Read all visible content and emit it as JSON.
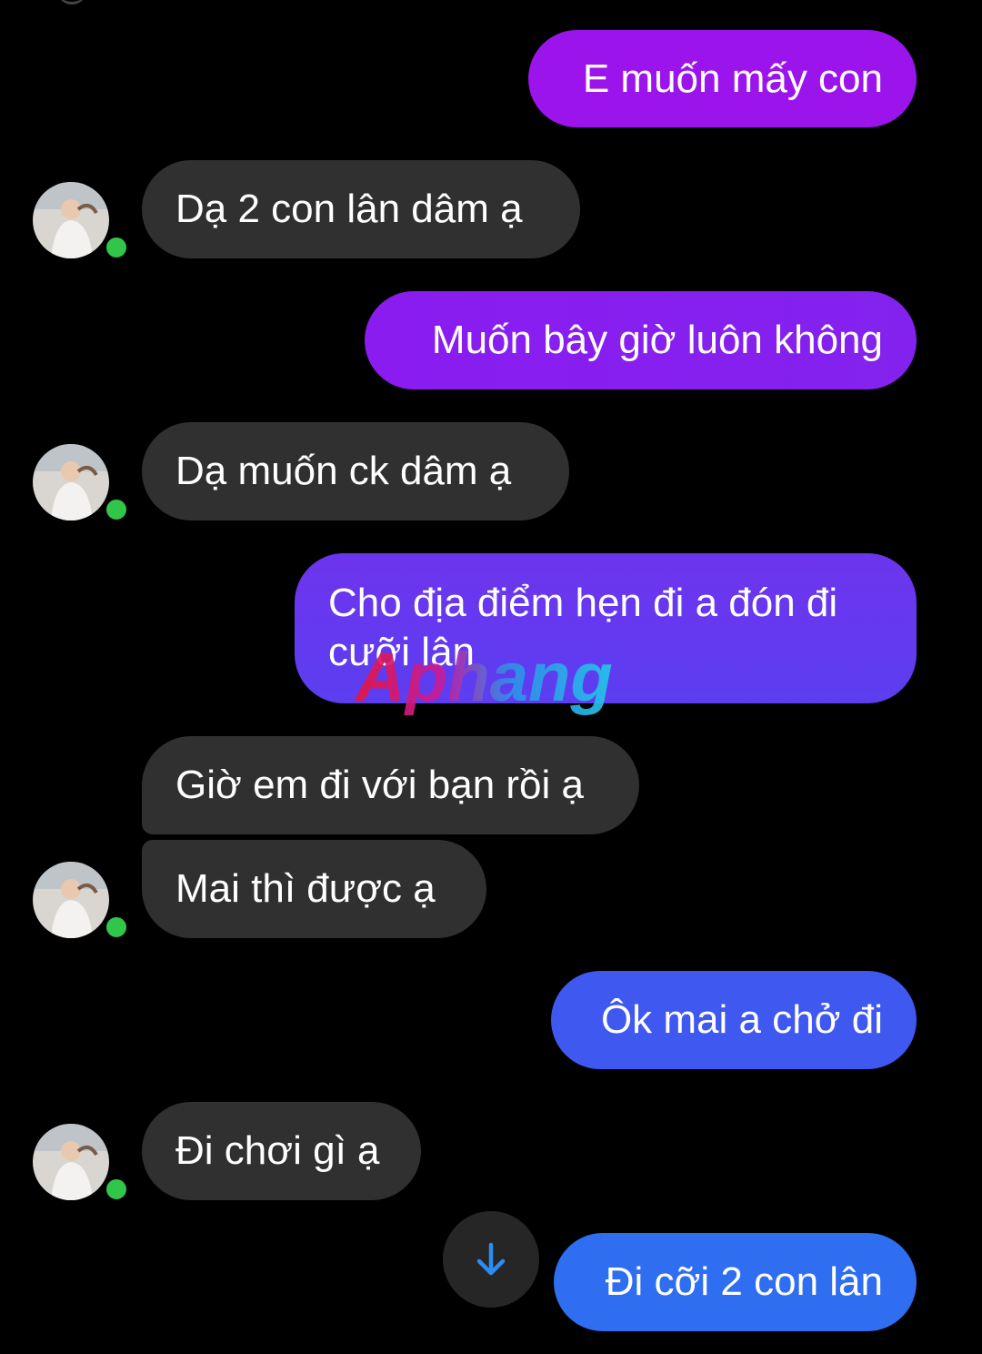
{
  "conversation": {
    "messages": [
      {
        "id": "m1",
        "direction": "outgoing",
        "text": "E muốn mấy con"
      },
      {
        "id": "m2",
        "direction": "incoming",
        "text": "Dạ 2 con lân dâm ạ"
      },
      {
        "id": "m3",
        "direction": "outgoing",
        "text": "Muốn bây giờ luôn không"
      },
      {
        "id": "m4",
        "direction": "incoming",
        "text": "Dạ muốn ck dâm ạ"
      },
      {
        "id": "m5",
        "direction": "outgoing",
        "text": "Cho địa điểm hẹn đi a đón đi cưỡi lân"
      },
      {
        "id": "m6",
        "direction": "incoming",
        "text": "Giờ em đi với bạn rồi ạ"
      },
      {
        "id": "m7",
        "direction": "incoming",
        "text": "Mai thì được ạ"
      },
      {
        "id": "m8",
        "direction": "outgoing",
        "text": "Ôk mai a chở đi"
      },
      {
        "id": "m9",
        "direction": "incoming",
        "text": "Đi chơi gì ạ"
      },
      {
        "id": "m10",
        "direction": "outgoing",
        "text": "Đi cỡi 2 con lân"
      }
    ]
  },
  "watermark": {
    "text": "Aphang"
  },
  "colors": {
    "background": "#000000",
    "incoming_bubble": "#303030",
    "online_dot": "#31c54a",
    "outgoing_gradient": [
      "#9b14ec",
      "#7a2df0",
      "#5b3ff0",
      "#3f5af0",
      "#2f6ef0"
    ],
    "scroll_arrow": "#2d8cf0"
  },
  "icons": {
    "scroll_button": "arrow-down-icon",
    "presence": "online-status-icon"
  }
}
